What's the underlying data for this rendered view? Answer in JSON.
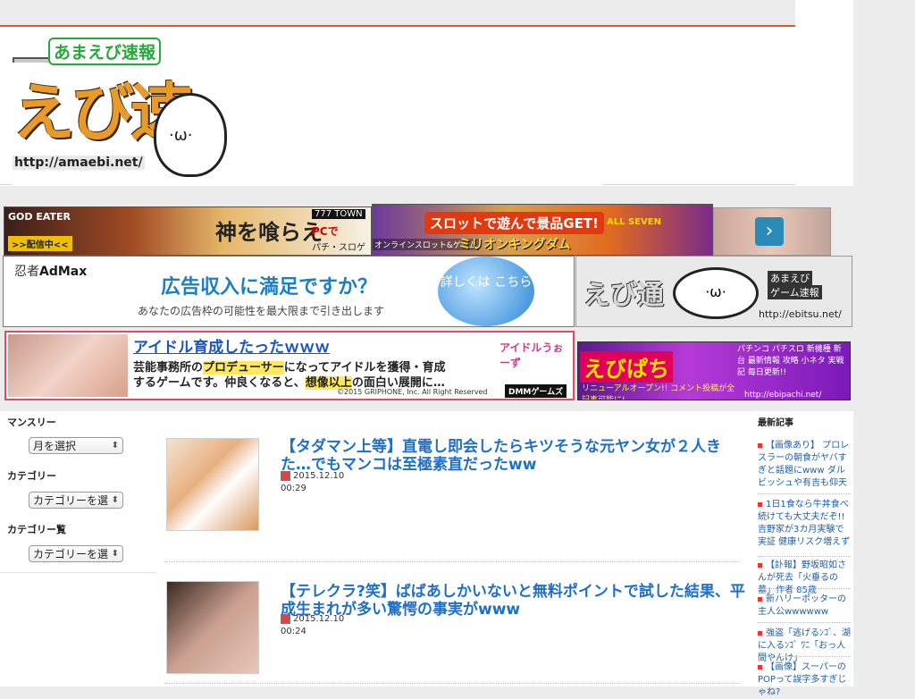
{
  "header": {
    "logo_sub": "あまえび速報",
    "logo_main": "えび速",
    "logo_face": "·ω·",
    "logo_url": "http://amaebi.net/"
  },
  "banners": {
    "godeater": {
      "title": "GOD EATER",
      "status": ">>配信中<<",
      "kami": "神を喰らえ",
      "town": "777 TOWN",
      "pc": "PCで",
      "pachi": "パチ・スロゲーム"
    },
    "slot": {
      "headline": "スロットで遊んで景品GET!",
      "sub": "オンラインスロット&ゲーム",
      "name": "ミリオンキングダム",
      "seven": "ALL SEVEN"
    },
    "next_arrow": "›",
    "admax": {
      "brand_pre": "忍者",
      "brand": "AdMax",
      "question": "広告収入に満足ですか？",
      "desc": "あなたの広告枠の可能性を最大限まで引き出します",
      "cta": "詳しくは こちら"
    },
    "ebitsu": {
      "name": "えび通",
      "face": "·ω·",
      "line1": "あまえび",
      "line2": "ゲーム速報",
      "url": "http://ebitsu.net/"
    },
    "idol": {
      "title": "アイドル育成したったｗｗｗ",
      "line1_a": "芸能事務所の",
      "line1_b": "プロデューサー",
      "line1_c": "になってアイドルを獲得・育成",
      "line2_a": "するゲームです。仲良くなると、",
      "line2_b": "想像以上",
      "line2_c": "の面白い展開に…",
      "copyright": "©2015 GRIPHONE, Inc. All Right Reserved",
      "brand": "DMMゲームズ",
      "logo": "アイドルうぉーず"
    },
    "ebipachi": {
      "name": "えびぱち",
      "menu": "パチンコ パチスロ 新機種 新台 最新情報 攻略 小ネタ 実戦記 毎日更新!!",
      "renewal": "リニューアルオープン!! コメント投稿が全記事可能に!",
      "url": "http://ebipachi.net/"
    }
  },
  "left_sidebar": {
    "monthly_heading": "マンスリー",
    "monthly_select": "月を選択",
    "category_heading": "カテゴリー",
    "category_select": "カテゴリーを選",
    "category_list_heading": "カテゴリー覧",
    "category_list_select": "カテゴリーを選"
  },
  "posts": [
    {
      "title": "【タダマン上等】直電し即会したらキツそうな元ヤン女が２人きた…でもマンコは至極素直だったww",
      "date": "2015.12.10",
      "time": "00:29"
    },
    {
      "title": "【テレクラ?笑】ばばあしかいないと無料ポイントで試した結果、平成生まれが多い驚愕の事実がwww",
      "date": "2015.12.10",
      "time": "00:24"
    }
  ],
  "right_sidebar": {
    "heading": "最新記事",
    "items": [
      "【画像あり】 プロレスラーの朝食がヤバすぎと話題にwww ダルビッシュや有吉も仰天",
      "1日1食なら牛丼食べ続けても大丈夫だぞ!! 吉野家が3カ月実験で実証 健康リスク増えず",
      "【訃報】野坂昭如さんが死去「火垂るの墓」作者 85歳",
      "新ハリーポッターの主人公wwwwww",
      "強盗「逃げるﾝｺﾞ、湖に入るﾝｺﾞ ﾜﾆ「おっ人間やんけ」",
      "【画像】スーパーのPOPって誤字多すぎじゃね?"
    ]
  },
  "colors": {
    "accent": "#e8572a",
    "link": "#1f6fc9",
    "title_link": "#1a55c8"
  }
}
